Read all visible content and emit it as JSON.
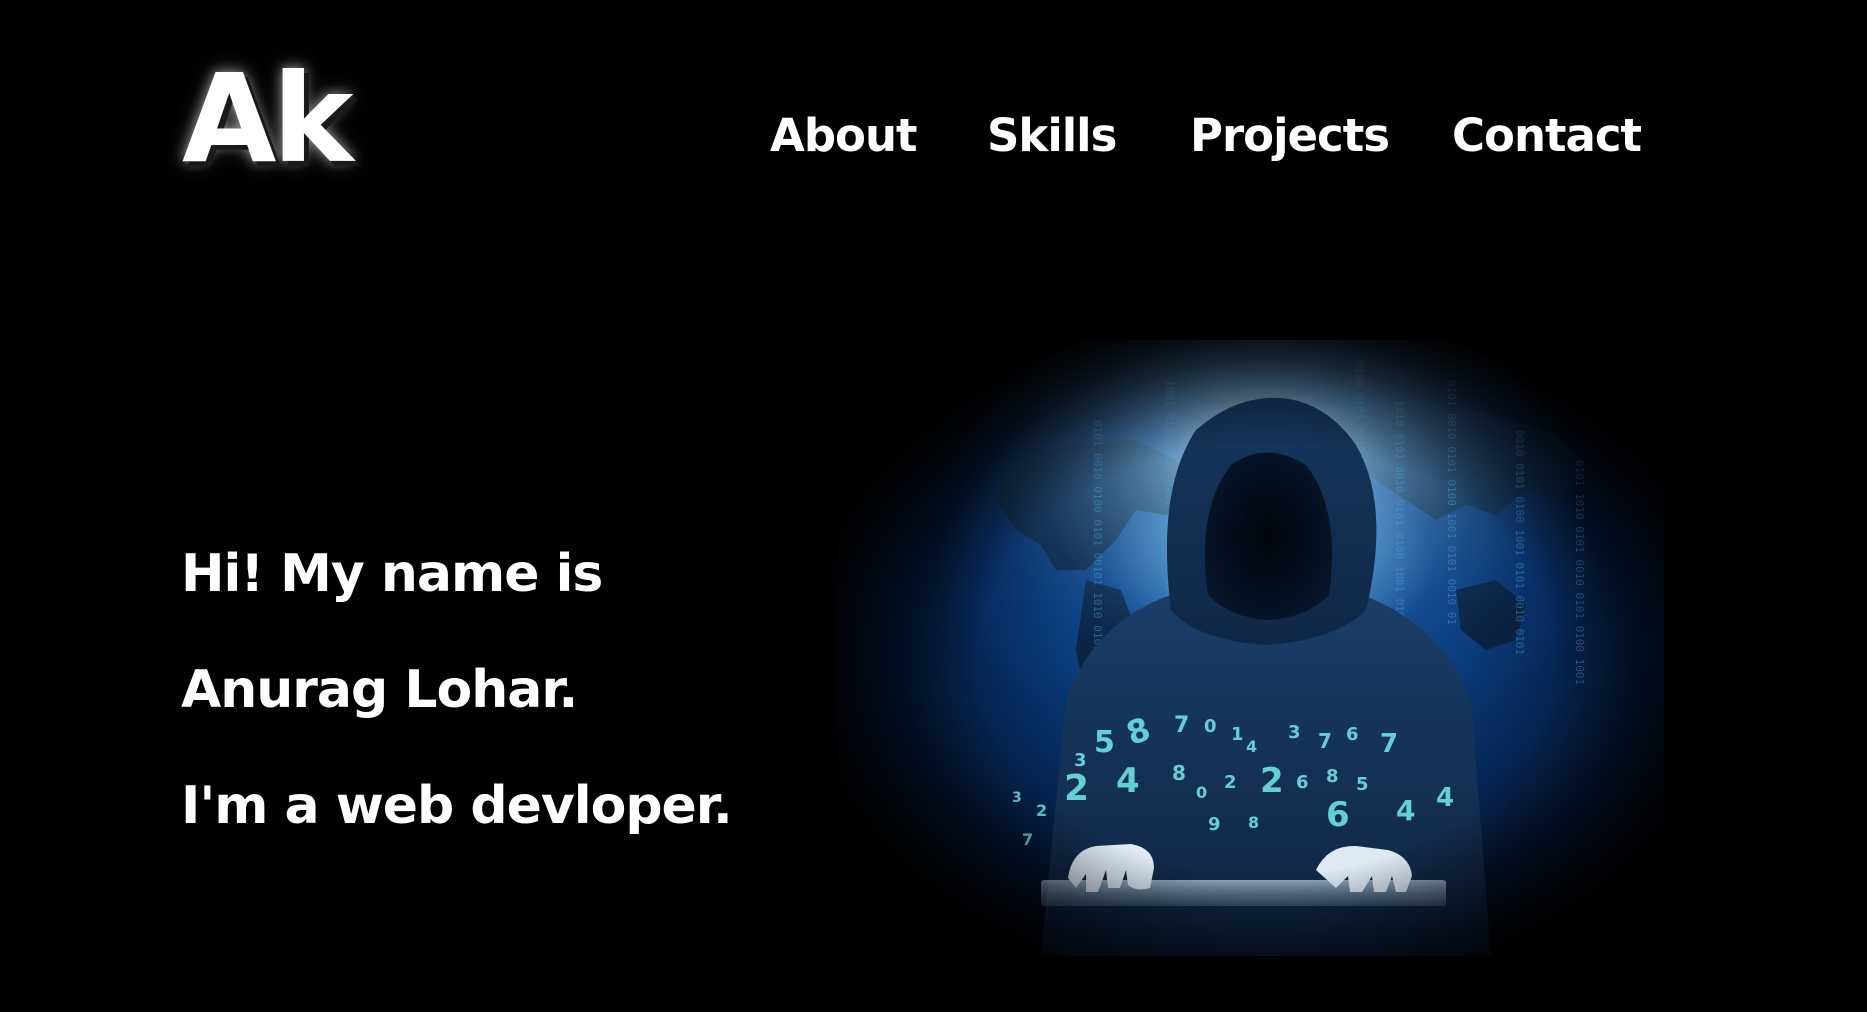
{
  "header": {
    "logo": "Ak",
    "nav": {
      "about": "About",
      "skills": "Skills",
      "projects": "Projects",
      "contact": "Contact"
    }
  },
  "hero": {
    "line1": "Hi! My name is",
    "line2": "Anurag Lohar.",
    "line3": "I'm a web devloper.",
    "image": {
      "subject": "hooded-hacker-at-keyboard",
      "digits": [
        "3",
        "5",
        "8",
        "7",
        "0",
        "1",
        "4",
        "3",
        "7",
        "6",
        "7",
        "2",
        "4",
        "8",
        "0",
        "2",
        "2",
        "6",
        "8",
        "5",
        "2",
        "7",
        "4",
        "9",
        "6",
        "5",
        "8",
        "4"
      ]
    }
  },
  "colors": {
    "background": "#000000",
    "text": "#ffffff",
    "accent": "#1e78c8"
  }
}
